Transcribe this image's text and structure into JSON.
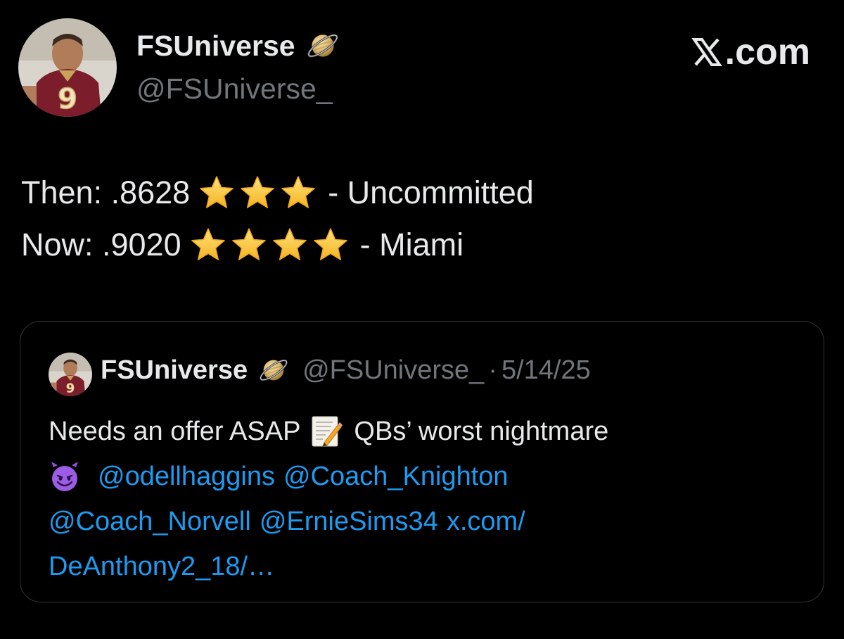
{
  "author": {
    "display_name": "FSUniverse",
    "handle": "@FSUniverse_",
    "badge_icon": "saturn-icon",
    "avatar_jersey_number": "9"
  },
  "brand": {
    "text": ".com",
    "logo_icon": "x-logo-icon"
  },
  "tweet": {
    "then_label": "Then: .8628",
    "then_stars": 3,
    "then_suffix": "- Uncommitted",
    "now_label": "Now: .9020",
    "now_stars": 4,
    "now_suffix": "- Miami",
    "star_icon": "star-icon"
  },
  "quote": {
    "display_name": "FSUniverse",
    "handle": "@FSUniverse_",
    "separator": "·",
    "date": "5/14/25",
    "text_part1": "Needs an offer ASAP",
    "memo_icon": "memo-icon",
    "text_part2": "QBs’ worst nightmare",
    "devil_icon": "smiling-devil-icon",
    "mentions": [
      "@odellhaggins",
      "@Coach_Knighton",
      "@Coach_Norvell",
      "@ErnieSims34"
    ],
    "link_part1": "x.com/",
    "link_part2": "DeAnthony2_18/…"
  },
  "colors": {
    "background": "#000000",
    "text": "#e7e9ea",
    "secondary_text": "#71767b",
    "link": "#1d9bf0",
    "card_border": "#2f3336",
    "star_fill": "#ffc83d"
  }
}
